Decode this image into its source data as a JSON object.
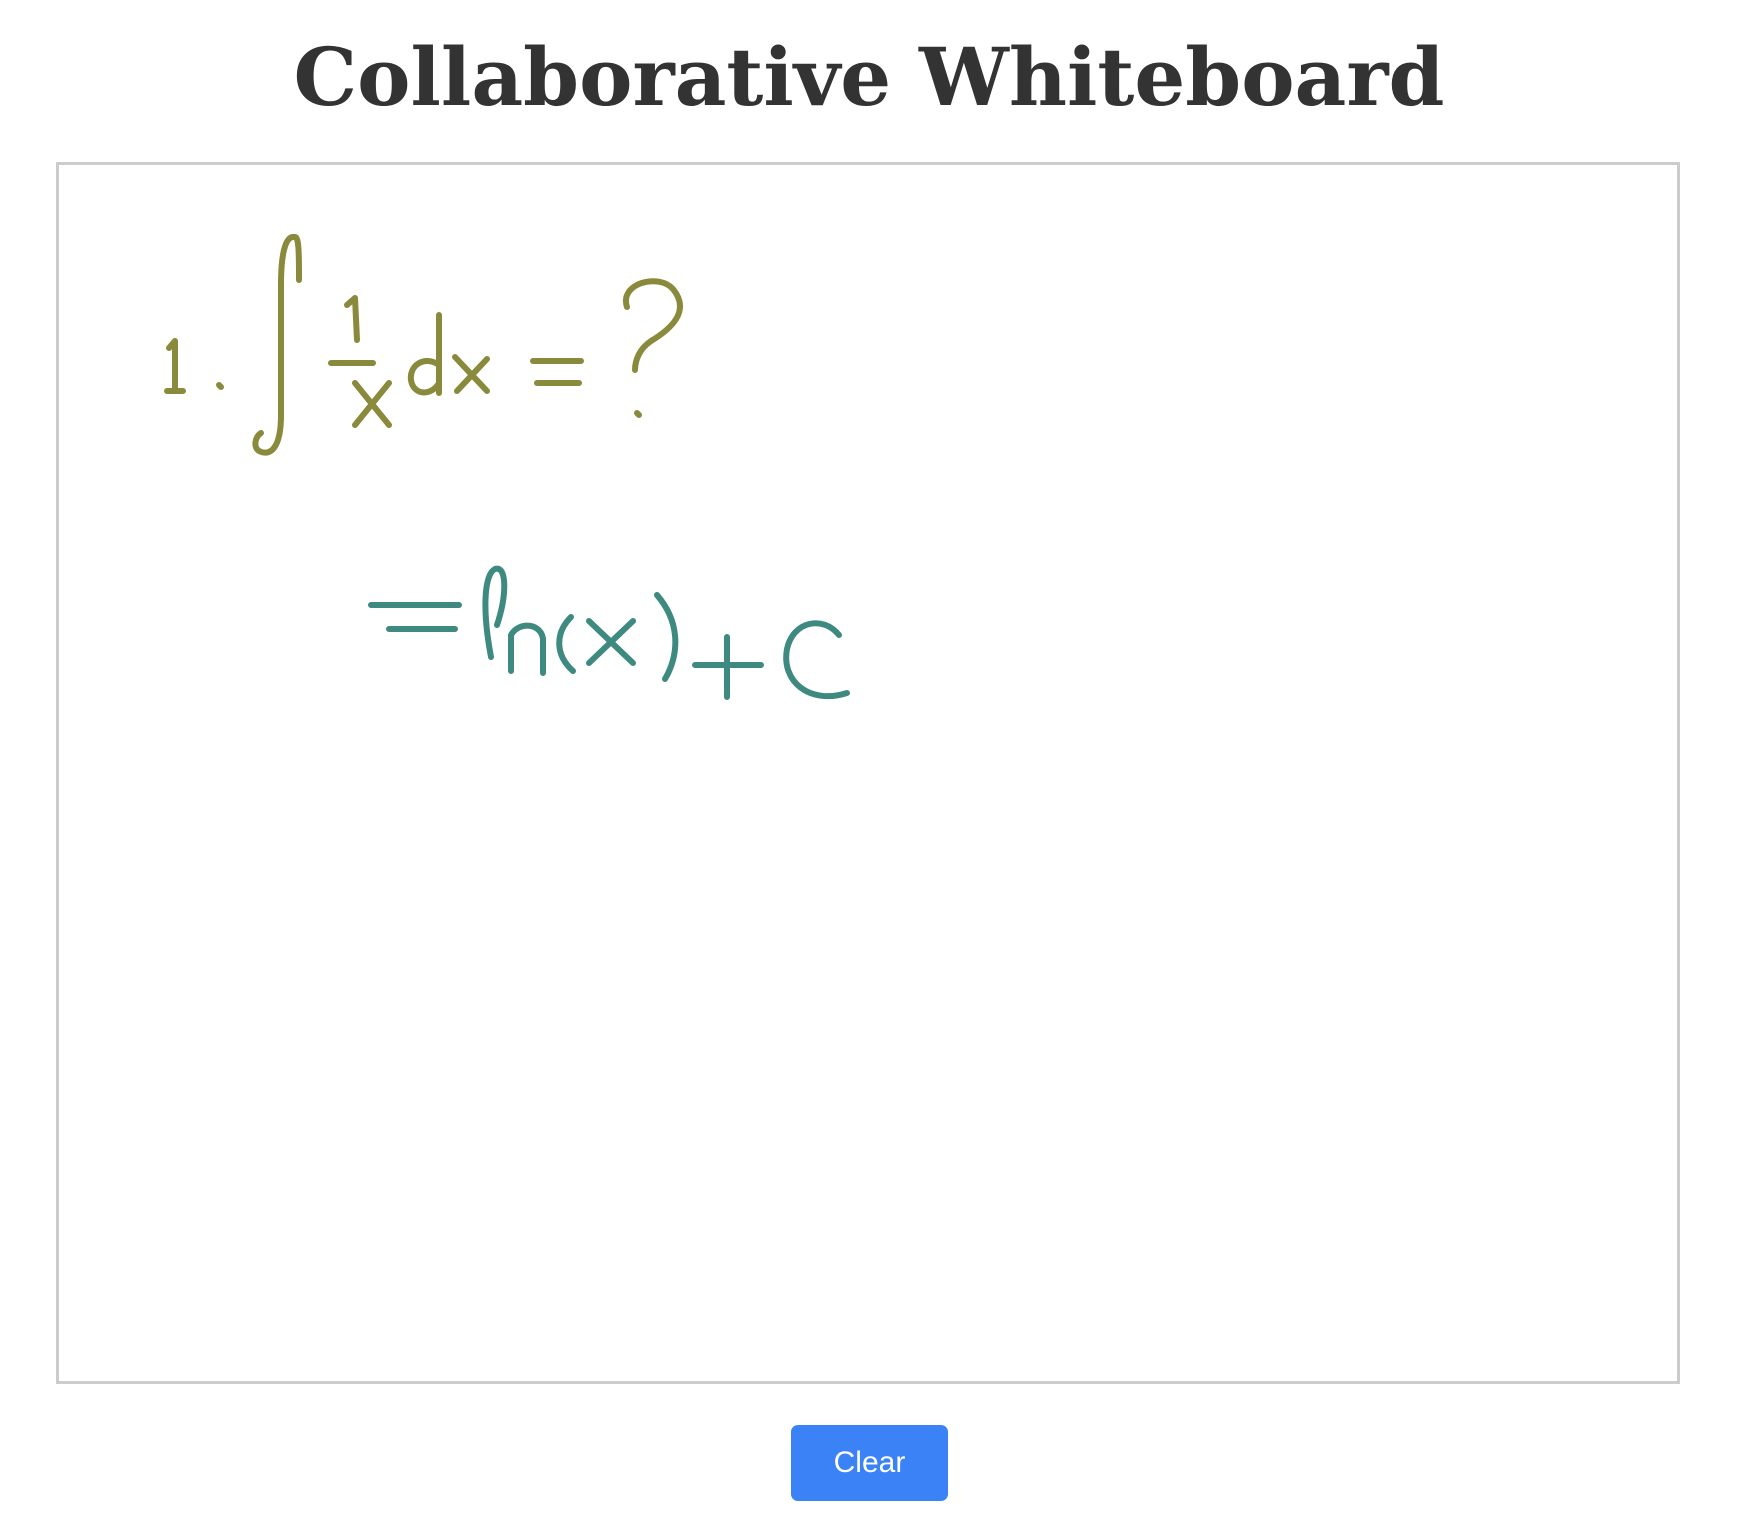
{
  "header": {
    "title": "Collaborative Whiteboard"
  },
  "whiteboard": {
    "stroke_colors": {
      "problem": "#8a8a3c",
      "answer": "#3e8a80"
    },
    "border_color": "#cccccc"
  },
  "toolbar": {
    "clear_label": "Clear",
    "clear_color": "#3b82f6"
  }
}
